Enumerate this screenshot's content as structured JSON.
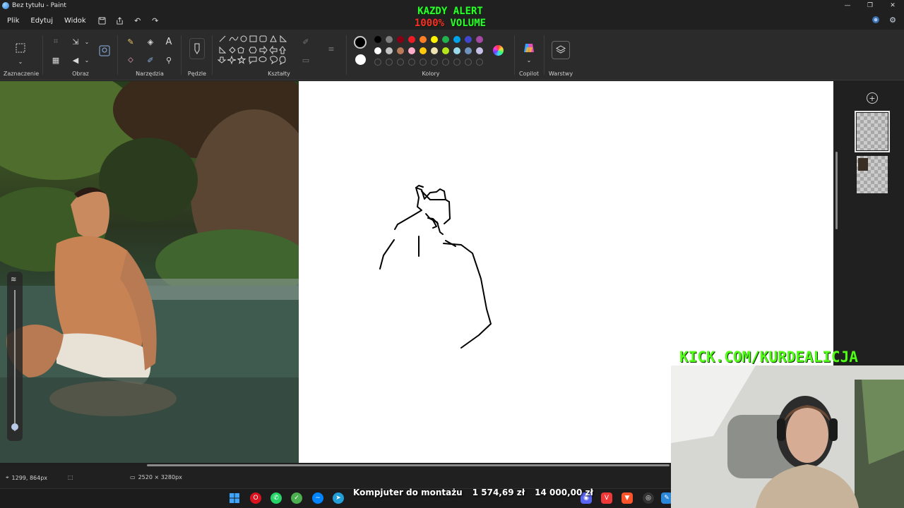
{
  "window": {
    "title": "Bez tytułu - Paint",
    "controls": [
      "—",
      "❐",
      "✕"
    ]
  },
  "menu": {
    "items": [
      "Plik",
      "Edytuj",
      "Widok"
    ]
  },
  "overlay": {
    "alert_line1": "KAZDY ALERT",
    "alert_percent": "1000%",
    "alert_word": "VOLUME",
    "kick_url": "KICK.COM/KURDEALICJA"
  },
  "ribbon": {
    "groups": {
      "selection": "Zaznaczenie",
      "image": "Obraz",
      "tools": "Narzędzia",
      "brushes": "Pędzle",
      "shapes": "Kształty",
      "colors": "Kolory",
      "copilot": "Copilot",
      "layers": "Warstwy"
    },
    "primary_color": "#000000",
    "secondary_color": "#ffffff",
    "palette_row1": [
      "#000000",
      "#7f7f7f",
      "#880015",
      "#ed1c24",
      "#ff7f27",
      "#fff200",
      "#22b14c",
      "#00a2e8",
      "#3f48cc",
      "#a349a4"
    ],
    "palette_row2": [
      "#ffffff",
      "#c3c3c3",
      "#b97a57",
      "#ffaec9",
      "#ffc90e",
      "#efe4b0",
      "#b5e61d",
      "#99d9ea",
      "#7092be",
      "#c8bfe7"
    ],
    "accent": "#4a8fe0"
  },
  "status": {
    "cursor_pos": "1299, 864px",
    "canvas_size": "2520 × 3280px"
  },
  "ticker": {
    "label": "Kompjuter do montażu",
    "current": "1 574,69 zł",
    "goal": "14 000,00 zł"
  },
  "taskbar": {
    "icons": [
      "windows-start",
      "opera",
      "whatsapp",
      "app-green",
      "messenger",
      "telegram",
      "discord",
      "vivaldi",
      "brave",
      "obs",
      "paint"
    ]
  }
}
